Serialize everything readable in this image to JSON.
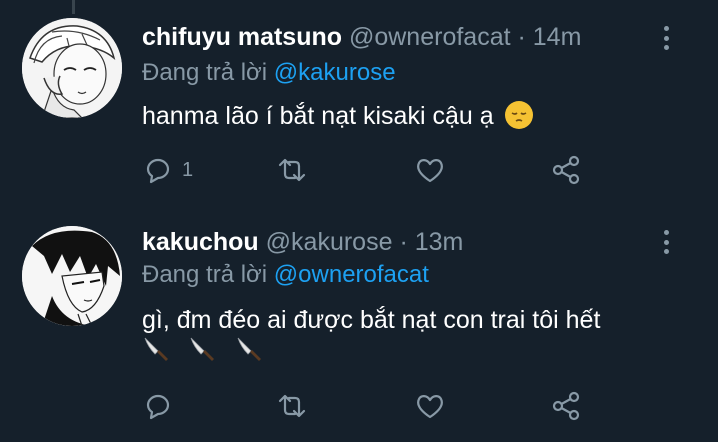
{
  "colors": {
    "background": "#15202b",
    "text": "#ffffff",
    "muted": "#8899a6",
    "link": "#1da1f2"
  },
  "tweets": [
    {
      "name": "chifuyu matsuno",
      "handle": "@ownerofacat",
      "separator": "·",
      "time": "14m",
      "reply_prefix": "Đang trả lời",
      "reply_to": "@kakurose",
      "text": "hanma lão í bắt nạt kisaki cậu ạ",
      "emoji": "pensive-face",
      "reply_count": "1",
      "icons": [
        "reply-icon",
        "retweet-icon",
        "like-icon",
        "share-icon",
        "more-icon"
      ]
    },
    {
      "name": "kakuchou",
      "handle": "@kakurose",
      "separator": "·",
      "time": "13m",
      "reply_prefix": "Đang trả lời",
      "reply_to": "@ownerofacat",
      "text": "gì, đm đéo ai được bắt nạt con trai tôi hết",
      "emoji": "knife x3",
      "reply_count": "",
      "icons": [
        "reply-icon",
        "retweet-icon",
        "like-icon",
        "share-icon",
        "more-icon"
      ]
    }
  ]
}
